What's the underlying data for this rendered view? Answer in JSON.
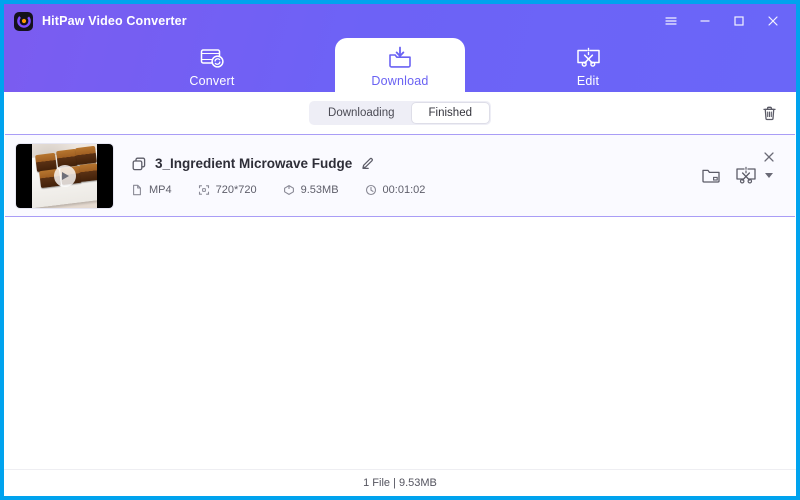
{
  "window": {
    "app_title": "HitPaw Video Converter",
    "border_color": "#00a3ee",
    "header_color": "#6d62f6",
    "accent_color": "#6a62f3"
  },
  "titlebar": {
    "logo_icon": "hitpaw-logo-icon",
    "menu_icon": "hamburger-menu-icon",
    "minimize_icon": "minimize-icon",
    "maximize_icon": "maximize-icon",
    "close_icon": "close-icon"
  },
  "nav": {
    "tabs": [
      {
        "label": "Convert",
        "icon": "convert-icon",
        "active": false
      },
      {
        "label": "Download",
        "icon": "download-folder-icon",
        "active": true
      },
      {
        "label": "Edit",
        "icon": "edit-scissors-icon",
        "active": false
      }
    ]
  },
  "subbar": {
    "segments": [
      {
        "label": "Downloading",
        "active": false
      },
      {
        "label": "Finished",
        "active": true
      }
    ],
    "trash_icon": "trash-icon"
  },
  "file": {
    "title": "3_Ingredient Microwave Fudge",
    "copy_icon": "copy-layers-icon",
    "rename_icon": "pencil-edit-icon",
    "play_icon": "play-icon",
    "meta": [
      {
        "icon": "file-icon",
        "value": "MP4"
      },
      {
        "icon": "resolution-icon",
        "value": "720*720"
      },
      {
        "icon": "size-icon",
        "value": "9.53MB"
      },
      {
        "icon": "clock-icon",
        "value": "00:01:02"
      }
    ],
    "actions": [
      {
        "icon": "folder-icon",
        "name": "open-folder-button"
      },
      {
        "icon": "edit-scissors-icon",
        "name": "edit-file-button"
      }
    ],
    "close_icon": "close-icon"
  },
  "footer": {
    "status": "1 File | 9.53MB"
  }
}
